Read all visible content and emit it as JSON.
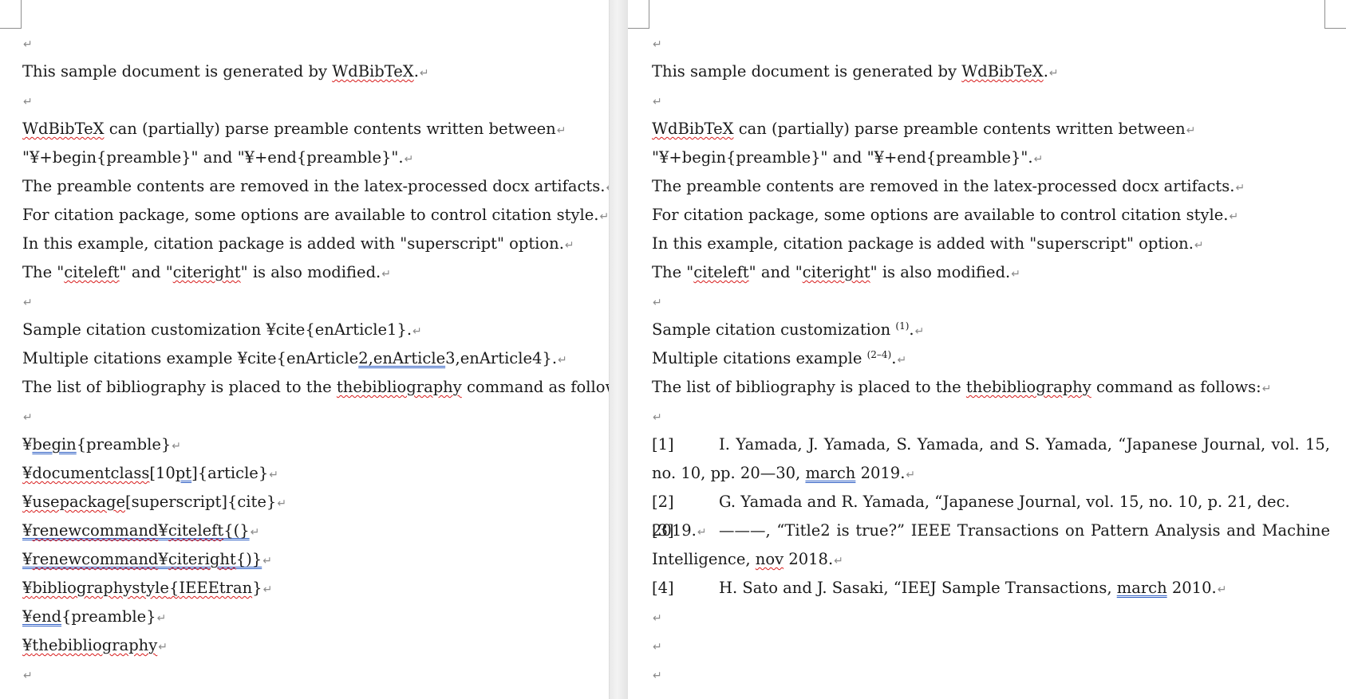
{
  "return_mark": "↵",
  "left": {
    "intro": "This sample document is generated by ",
    "tool": "WdBibTeX",
    "intro_end": ".",
    "tool2": "WdBibTeX",
    "parse": " can (partially) parse preamble contents written between",
    "between": "\"¥+begin{preamble}\" and \"¥+end{preamble}\".",
    "removed": "The preamble contents are removed in the latex-processed docx artifacts.",
    "options": "For citation package, some options are available to control citation style.",
    "example": "In this example, citation package is added with \"superscript\" option.",
    "mod_a": "The \"",
    "citeleft": "citeleft",
    "mod_b": "\" and \"",
    "citeright": "citeright",
    "mod_c": "\" is also modified.",
    "sample_cite": "Sample citation customization ¥cite{enArticle1}.",
    "multi_a": "Multiple citations example ¥cite{enArticle",
    "multi_b": "2,enArticle",
    "multi_c": "3,enArticle4}.",
    "list_a": "The list of bibliography is placed to the ",
    "thebib": "thebibliography",
    "list_b": " command as follows:",
    "code": {
      "yen": "¥",
      "begin": "begin",
      "begin_rest": "{preamble}",
      "docclass": "documentclass",
      "docclass_b": "[10",
      "docclass_pt": "pt",
      "docclass_c": "]{article}",
      "usepkg": "usepackage",
      "usepkg_rest": "[superscript]{cite}",
      "renew1": "renewcommand",
      "renew1_yen": "¥",
      "citeleft": "citeleft",
      "renew1_rest": "{(}",
      "renew2": "renewcommand",
      "renew2_yen": "¥",
      "citeright": "citeright",
      "renew2_rest": "{)}",
      "bibstyle": "bibliographystyle",
      "bibstyle_b": "{",
      "ieeetran": "IEEEtran",
      "bibstyle_c": "}",
      "end": "end",
      "end_rest": "{preamble}",
      "thebib": "thebibliography"
    }
  },
  "right": {
    "intro": "This sample document is generated by ",
    "tool": "WdBibTeX",
    "intro_end": ".",
    "tool2": "WdBibTeX",
    "parse": " can (partially) parse preamble contents written between",
    "between": "\"¥+begin{preamble}\" and \"¥+end{preamble}\".",
    "removed": "The preamble contents are removed in the latex-processed docx artifacts.",
    "options": "For citation package, some options are available to control citation style.",
    "example": "In this example, citation package is added with \"superscript\" option.",
    "mod_a": "The \"",
    "citeleft": "citeleft",
    "mod_b": "\" and \"",
    "citeright": "citeright",
    "mod_c": "\" is also modified.",
    "sample_cite": "Sample citation customization ",
    "sample_sup": "(1)",
    "sample_end": ".",
    "multi": "Multiple citations example ",
    "multi_sup": "(2–4)",
    "multi_end": ".",
    "list_a": "The list of bibliography is placed to the ",
    "thebib": "thebibliography",
    "list_b": " command as follows:",
    "bibliography": {
      "b1_label": "[1]",
      "b1_text": "I. Yamada, J. Yamada, S. Yamada, and S. Yamada, “Japanese Journal, vol. 15, no. 10, pp. 20—30, ",
      "b1_month": "march",
      "b1_end": " 2019.",
      "b2_label": "[2]",
      "b2_text": "G. Yamada and R. Yamada, “Japanese Journal, vol. 15, no. 10, p. 21, dec. 2019.",
      "b3_label": "[3]",
      "b3_text": "———, “Title2 is true?” IEEE Transactions on Pattern Analysis and Machine Intelligence, ",
      "b3_month": "nov",
      "b3_end": " 2018.",
      "b4_label": "[4]",
      "b4_text": "H. Sato and J. Sasaki, “IEEJ Sample Transactions, ",
      "b4_month": "march",
      "b4_end": " 2010."
    }
  }
}
